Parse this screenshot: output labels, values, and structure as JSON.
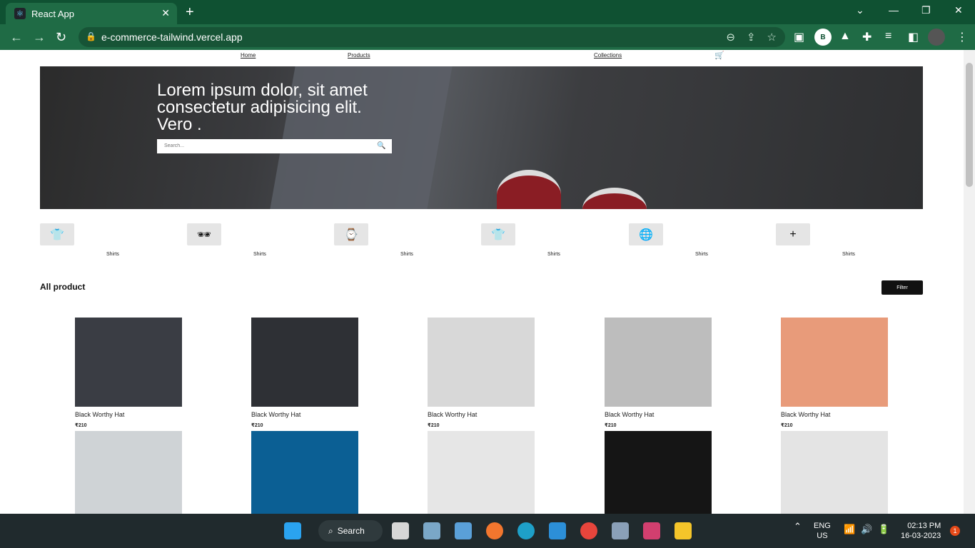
{
  "browser": {
    "tab_title": "React App",
    "url": "e-commerce-tailwind.vercel.app",
    "profile_initial": "B"
  },
  "nav": {
    "home": "Home",
    "products": "Products",
    "collections": "Collections"
  },
  "hero": {
    "heading": "Lorem ipsum dolor, sit amet consectetur adipisicing elit. Vero .",
    "search_placeholder": "Search..."
  },
  "categories": [
    {
      "icon": "tshirt-icon",
      "label": "Shirts",
      "glyph": "👕"
    },
    {
      "icon": "sunglasses-icon",
      "label": "Shirts",
      "glyph": "🕶"
    },
    {
      "icon": "watch-icon",
      "label": "Shirts",
      "glyph": "⌚"
    },
    {
      "icon": "tshirt-icon",
      "label": "Shirts",
      "glyph": "👕"
    },
    {
      "icon": "globe-icon",
      "label": "Shirts",
      "glyph": "🌐"
    },
    {
      "icon": "plus-icon",
      "label": "Shirts",
      "glyph": "+"
    }
  ],
  "products_section": {
    "title": "All product",
    "filter_label": "Filter"
  },
  "products": [
    {
      "name": "Black Worthy Hat",
      "price": "₹210",
      "color": "#3a3d44"
    },
    {
      "name": "Black Worthy Hat",
      "price": "₹210",
      "color": "#2e3035"
    },
    {
      "name": "Black Worthy Hat",
      "price": "₹210",
      "color": "#d8d8d8"
    },
    {
      "name": "Black Worthy Hat",
      "price": "₹210",
      "color": "#bdbdbd"
    },
    {
      "name": "Black Worthy Hat",
      "price": "₹210",
      "color": "#e89b7a"
    },
    {
      "name": "",
      "price": "",
      "color": "#cfd3d6"
    },
    {
      "name": "",
      "price": "",
      "color": "#0b5f94"
    },
    {
      "name": "",
      "price": "",
      "color": "#e6e6e6"
    },
    {
      "name": "",
      "price": "",
      "color": "#151515"
    },
    {
      "name": "",
      "price": "",
      "color": "#e4e4e4"
    }
  ],
  "taskbar": {
    "search_label": "Search",
    "lang": "ENG",
    "region": "US",
    "time": "02:13 PM",
    "date": "16-03-2023",
    "notifications": "1"
  }
}
